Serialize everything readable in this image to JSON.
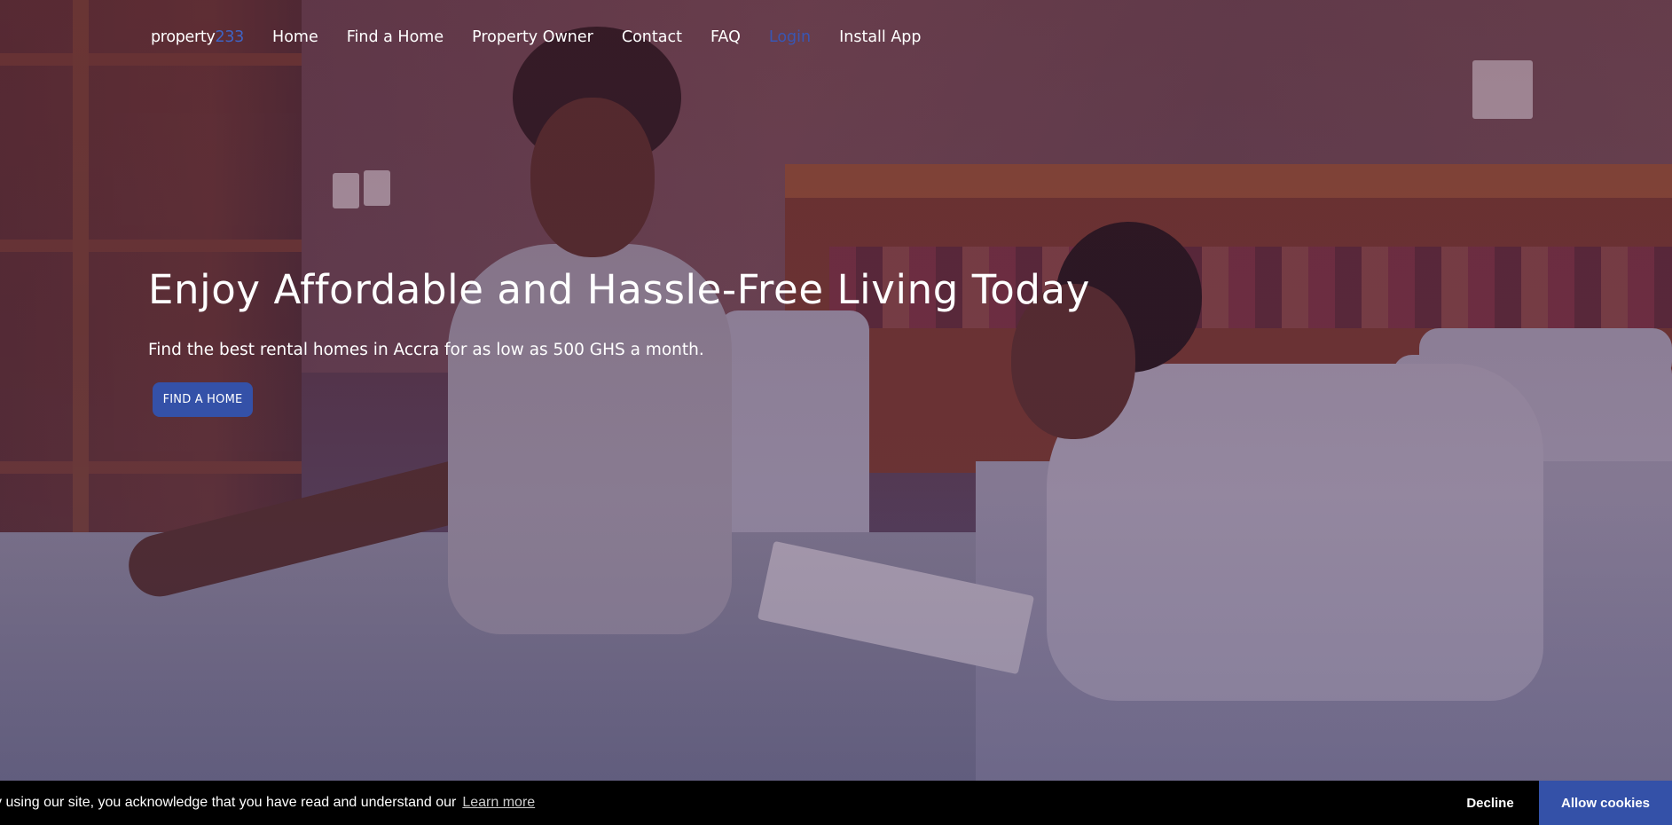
{
  "brand": {
    "logo_text": "property",
    "logo_number": "233",
    "accent_color": "#3451a8"
  },
  "nav": {
    "items": [
      {
        "label": "Home"
      },
      {
        "label": "Find a Home"
      },
      {
        "label": "Property Owner"
      },
      {
        "label": "Contact"
      },
      {
        "label": "FAQ"
      },
      {
        "label": "Login"
      },
      {
        "label": "Install App"
      }
    ]
  },
  "hero": {
    "headline": "Enjoy Affordable and Hassle-Free Living Today",
    "subline": "Find the best rental homes in Accra for as low as 500 GHS a month.",
    "cta_label": "FIND A HOME",
    "image": "photo of two women smiling in a bedroom"
  },
  "cookie_bar": {
    "message": "y using our site, you acknowledge that you have read and understand our",
    "learn_more": "Learn more",
    "decline_label": "Decline",
    "allow_label": "Allow cookies"
  }
}
